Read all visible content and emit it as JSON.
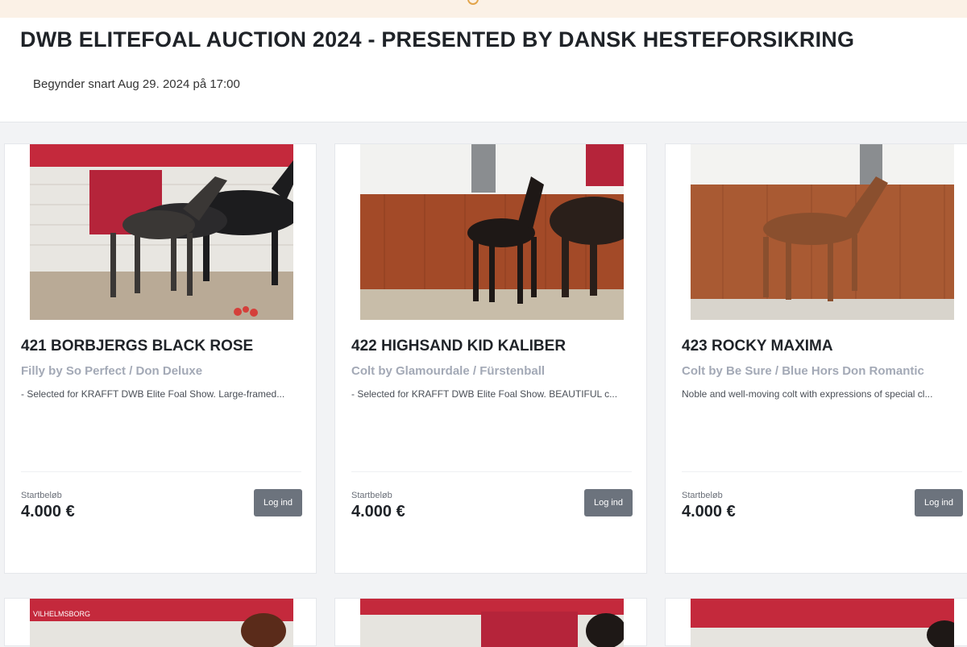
{
  "header": {
    "title": "DWB ELITEFOAL AUCTION 2024 - PRESENTED BY DANSK HESTEFORSIKRING",
    "starts": "Begynder snart Aug 29. 2024 på 17:00"
  },
  "lots": [
    {
      "title": "421 BORBJERGS BLACK ROSE",
      "pedigree": "Filly by So Perfect / Don Deluxe",
      "description": "- Selected for KRAFFT DWB Elite Foal Show. Large-framed...",
      "price_label": "Startbeløb",
      "price": "4.000 €",
      "button": "Log ind"
    },
    {
      "title": "422 HIGHSAND KID KALIBER",
      "pedigree": "Colt by Glamourdale / Fürstenball",
      "description": "- Selected for KRAFFT DWB Elite Foal Show. BEAUTIFUL c...",
      "price_label": "Startbeløb",
      "price": "4.000 €",
      "button": "Log ind"
    },
    {
      "title": "423 ROCKY MAXIMA",
      "pedigree": "Colt by Be Sure / Blue Hors Don Romantic",
      "description": "Noble and well-moving colt with expressions of special cl...",
      "price_label": "Startbeløb",
      "price": "4.000 €",
      "button": "Log ind"
    }
  ],
  "next_row_photo_text": "VILHELMSBORG",
  "colors": {
    "button": "#6c737d",
    "pedigree": "#a3a9b6",
    "banner_red": "#c8293f"
  }
}
